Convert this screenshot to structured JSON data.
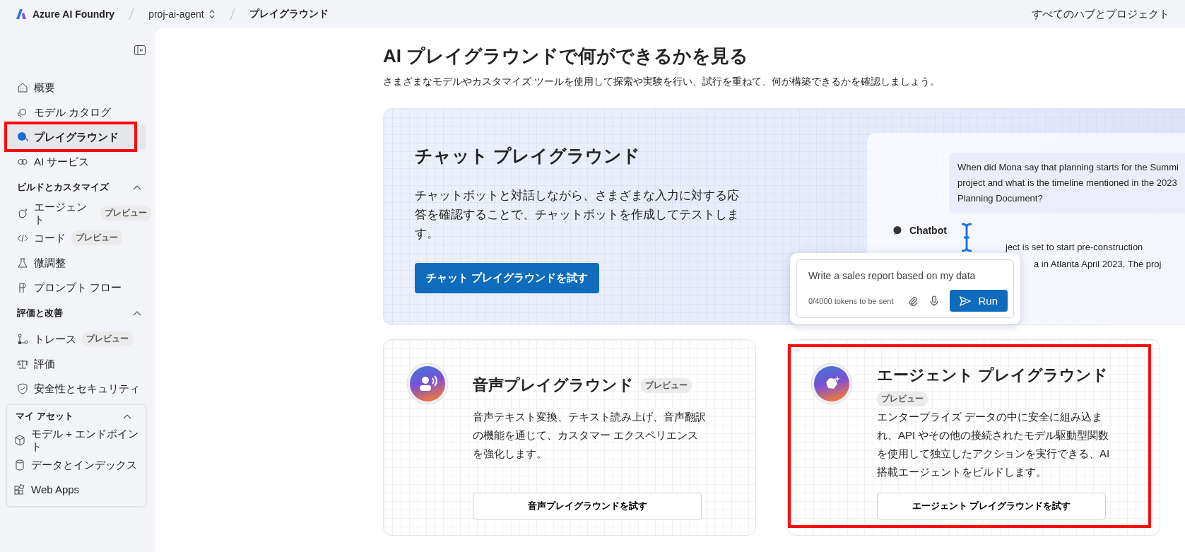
{
  "top_bar": {
    "app_name": "Azure AI Foundry",
    "project": "proj-ai-agent",
    "page": "プレイグラウンド",
    "hubs_link": "すべてのハブとプロジェクト"
  },
  "sidebar": {
    "groups": [
      {
        "items": [
          {
            "label": "概要",
            "selected": false,
            "highlighted": false
          },
          {
            "label": "モデル カタログ",
            "selected": false,
            "highlighted": false
          },
          {
            "label": "プレイグラウンド",
            "selected": true,
            "highlighted": true
          },
          {
            "label": "AI サービス",
            "selected": false,
            "highlighted": false
          }
        ]
      },
      {
        "title": "ビルドとカスタマイズ",
        "expanded": true,
        "items": [
          {
            "label": "エージェント",
            "badge": "プレビュー",
            "selected": false,
            "highlighted": false
          },
          {
            "label": "コード",
            "badge": "プレビュー",
            "selected": false,
            "highlighted": false
          },
          {
            "label": "微調整",
            "selected": false,
            "highlighted": false
          },
          {
            "label": "プロンプト フロー",
            "selected": false,
            "highlighted": false
          }
        ]
      },
      {
        "title": "評価と改善",
        "expanded": true,
        "items": [
          {
            "label": "トレース",
            "badge": "プレビュー",
            "selected": false,
            "highlighted": false
          },
          {
            "label": "評価",
            "selected": false,
            "highlighted": false
          },
          {
            "label": "安全性とセキュリティ",
            "selected": false,
            "highlighted": false
          }
        ]
      },
      {
        "title": "マイ アセット",
        "expanded": true,
        "boxed": true,
        "items": [
          {
            "label": "モデル + エンドポイント",
            "selected": false,
            "highlighted": false
          },
          {
            "label": "データとインデックス",
            "selected": false,
            "highlighted": false
          },
          {
            "label": "Web Apps",
            "selected": false,
            "highlighted": false
          }
        ]
      }
    ]
  },
  "main": {
    "title": "AI プレイグラウンドで何ができるかを見る",
    "subtitle": "さまざまなモデルやカスタマイズ ツールを使用して探索や実験を行い、試行を重ねて、何が構築できるかを確認しましょう。",
    "hero": {
      "title": "チャット プレイグラウンド",
      "description": "チャットボットと対話しながら、さまざまな入力に対する応答を確認することで、チャットボットを作成してテストします。",
      "button": "チャット プレイグラウンドを試す",
      "preview": {
        "user_message": [
          "When did Mona say that planning starts for the Summi",
          "project and what is the timeline mentioned in the 2023",
          "Planning Document?"
        ],
        "bot_name": "Chatbot",
        "bot_lines": [
          "ject is set to start pre-construction",
          "a in Atlanta April 2023. The proj"
        ],
        "input_value": "Write a sales report based on my data",
        "token_count": "0/4000 tokens to be sent",
        "run_button": "Run"
      }
    },
    "cards": [
      {
        "title": "音声プレイグラウンド",
        "badge": "プレビュー",
        "description": "音声テキスト変換、テキスト読み上げ、音声翻訳の機能を通じて、カスタマー エクスペリエンスを強化します。",
        "button": "音声プレイグラウンドを試す",
        "highlighted": false
      },
      {
        "title": "エージェント プレイグラウンド",
        "badge": "プレビュー",
        "description": "エンタープライズ データの中に安全に組み込まれ、API やその他の接続されたモデル駆動型関数を使用して独立したアクションを実行できる、AI 搭載エージェントをビルドします。",
        "button": "エージェント プレイグラウンドを試す",
        "highlighted": true
      }
    ]
  }
}
